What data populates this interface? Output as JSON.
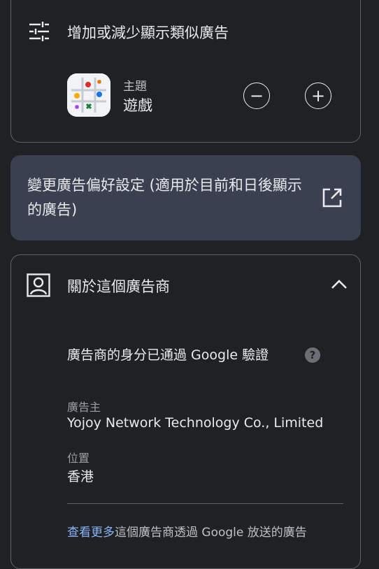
{
  "controls": {
    "title": "增加或減少顯示類似廣告",
    "topic_label": "主題",
    "topic_name": "遊戲",
    "decrease_label": "−",
    "increase_label": "+"
  },
  "settings_banner": {
    "text": "變更廣告偏好設定 (適用於目前和日後顯示的廣告)"
  },
  "about": {
    "title": "關於這個廣告商",
    "verified_text": "廣告商的身分已通過 Google 驗證",
    "help_label": "?",
    "advertiser_label": "廣告主",
    "advertiser_name": "Yojoy Network Technology Co., Limited",
    "location_label": "位置",
    "location_value": "香港",
    "see_more_link": "查看更多",
    "see_more_rest": "這個廣告商透過 Google 放送的廣告"
  },
  "colors": {
    "background": "#202124",
    "banner": "#3b4050",
    "link": "#8ab4f8"
  },
  "icons": [
    "sliders-icon",
    "game-app-icon",
    "open-in-new-icon",
    "person-icon",
    "chevron-up-icon",
    "help-icon"
  ]
}
